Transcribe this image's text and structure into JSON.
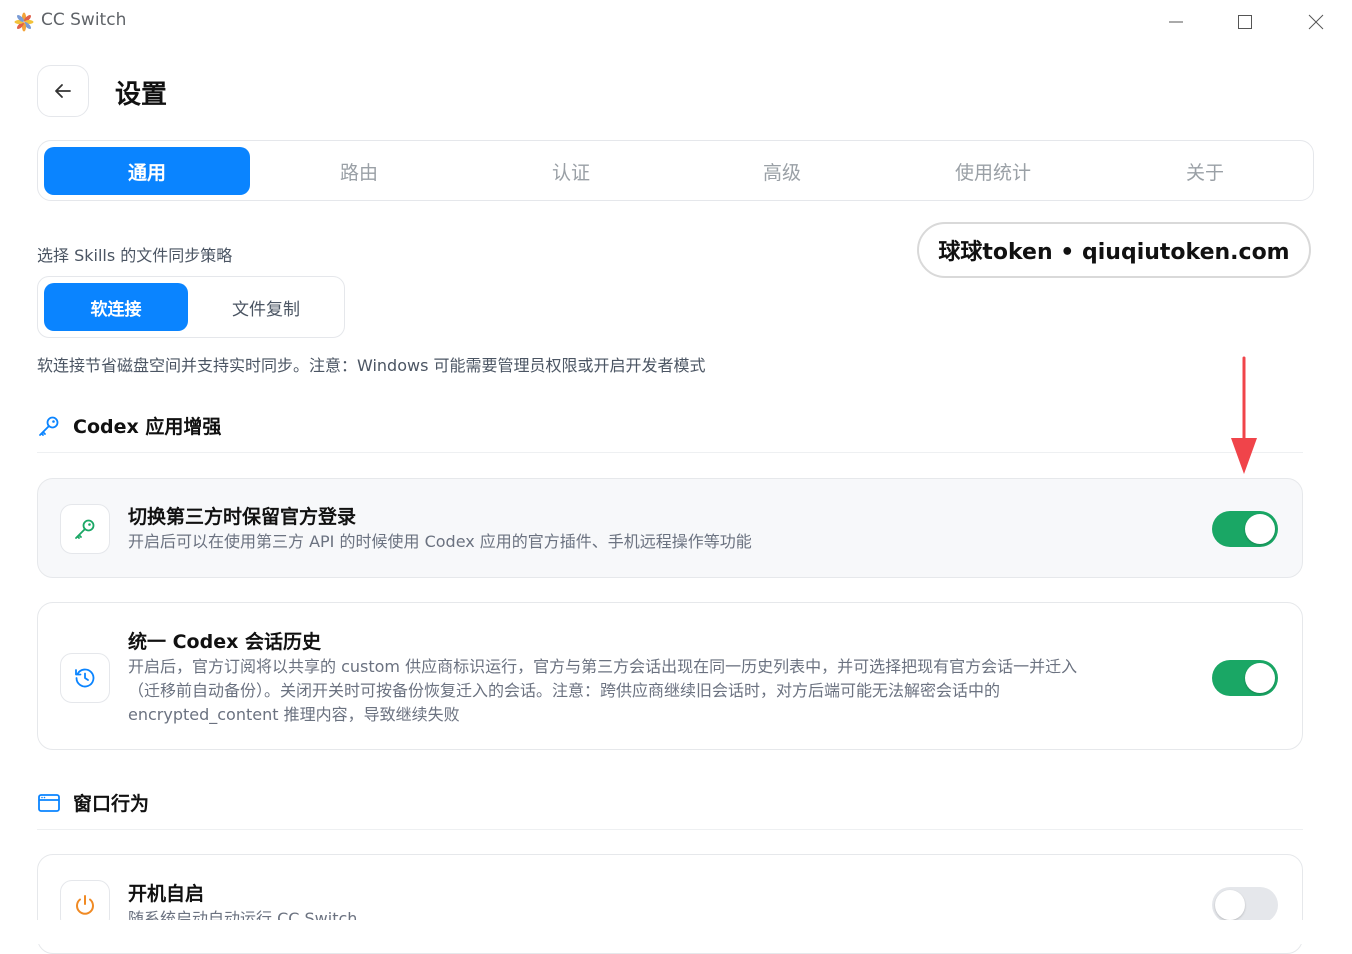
{
  "window": {
    "title": "CC Switch",
    "controls": [
      "minimize-icon",
      "maximize-icon",
      "close-icon"
    ]
  },
  "header": {
    "back_icon": "arrow-left-icon",
    "title": "设置"
  },
  "tabs": [
    {
      "label": "通用",
      "active": true
    },
    {
      "label": "路由",
      "active": false
    },
    {
      "label": "认证",
      "active": false
    },
    {
      "label": "高级",
      "active": false
    },
    {
      "label": "使用统计",
      "active": false
    },
    {
      "label": "关于",
      "active": false
    }
  ],
  "skills": {
    "label": "选择 Skills 的文件同步策略",
    "options": [
      {
        "label": "软连接",
        "active": true
      },
      {
        "label": "文件复制",
        "active": false
      }
    ],
    "note": "软连接节省磁盘空间并支持实时同步。注意：Windows 可能需要管理员权限或开启开发者模式"
  },
  "watermark": "球球token • qiuqiutoken.com",
  "codex_section": {
    "icon": "key-icon",
    "title": "Codex 应用增强",
    "items": [
      {
        "icon": "key-icon",
        "title": "切换第三方时保留官方登录",
        "description": "开启后可以在使用第三方 API 的时候使用 Codex 应用的官方插件、手机远程操作等功能",
        "enabled": true
      },
      {
        "icon": "history-icon",
        "title": "统一 Codex 会话历史",
        "description_lines": [
          "开启后，官方订阅将以共享的 custom 供应商标识运行，官方与第三方会话出现在同一历史列表中，并可选择把现有官方会话一并迁入",
          "（迁移前自动备份）。关闭开关时可按备份恢复迁入的会话。注意：跨供应商继续旧会话时，对方后端可能无法解密会话中的",
          "encrypted_content 推理内容，导致继续失败"
        ],
        "enabled": true
      }
    ]
  },
  "window_section": {
    "icon": "window-icon",
    "title": "窗口行为",
    "items": [
      {
        "icon": "power-icon",
        "title": "开机自启",
        "description": "随系统启动自动运行 CC Switch",
        "enabled": false
      }
    ]
  },
  "colors": {
    "accent": "#0a84ff",
    "toggle_on": "#1aa765",
    "annotation_arrow": "#f0444a",
    "power_icon": "#f08a24"
  }
}
